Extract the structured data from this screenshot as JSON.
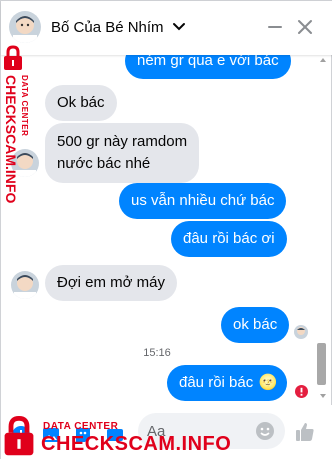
{
  "header": {
    "contact_name": "Bố Của Bé Nhím",
    "avatar_icon": "baby-avatar-icon",
    "dropdown_icon": "chevron-down-icon",
    "minimize_icon": "minimize-icon",
    "close_icon": "close-icon"
  },
  "messages": [
    {
      "direction": "out",
      "text": "ném gr qua e với bác"
    },
    {
      "direction": "in",
      "text": "Ok bác"
    },
    {
      "direction": "in",
      "text": "500 gr này ramdom"
    },
    {
      "direction": "in",
      "text": "nước bác nhé"
    },
    {
      "direction": "out",
      "text": "us vẫn nhiều chứ bác"
    },
    {
      "direction": "out",
      "text": "đâu rồi bác ơi"
    },
    {
      "direction": "in",
      "text": "Đợi em mở máy"
    },
    {
      "direction": "out",
      "text": "ok bác"
    },
    {
      "direction": "out",
      "text": "đâu rồi bác",
      "emoji": "🌝"
    }
  ],
  "timestamp": "15:16",
  "status": {
    "failed_icon": "error-icon",
    "failed_color": "#e41e3f"
  },
  "composer": {
    "placeholder": "Aa",
    "icons": [
      "plus-circle-icon",
      "image-icon",
      "sticker-icon",
      "gif-icon"
    ],
    "emoji_icon": "smiley-icon",
    "like_icon": "thumbs-up-icon"
  },
  "watermark": {
    "side_small": "DATA CENTER",
    "side_big": "CHECKSCAM.INFO",
    "bottom_small": "DATA CENTER",
    "bottom_big": "CHECKSCAM.INFO",
    "color": "#e0001b"
  },
  "colors": {
    "outgoing": "#0084ff",
    "incoming": "#e4e6eb",
    "accent": "#0084ff"
  }
}
